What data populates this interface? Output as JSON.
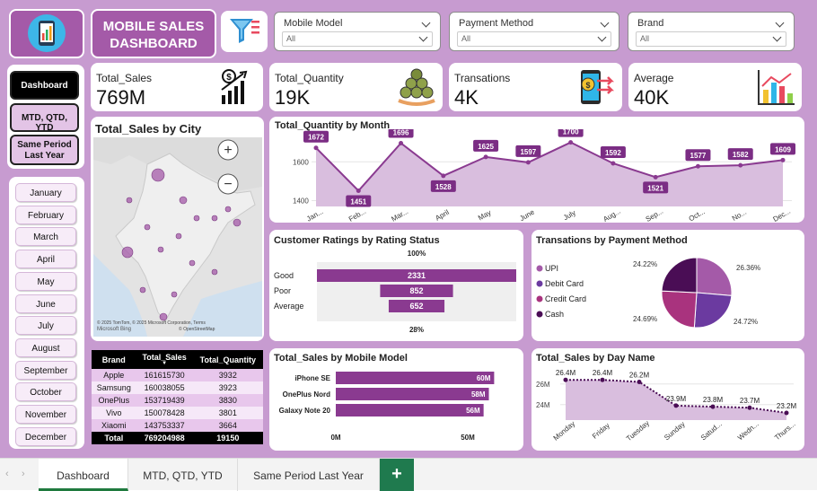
{
  "header": {
    "title_line1": "MOBILE SALES",
    "title_line2": "DASHBOARD"
  },
  "slicers": [
    {
      "label": "Mobile Model",
      "value": "All"
    },
    {
      "label": "Payment Method",
      "value": "All"
    },
    {
      "label": "Brand",
      "value": "All"
    }
  ],
  "nav": {
    "dashboard": "Dashboard",
    "mtd": "MTD, QTD, YTD",
    "same_period_line1": "Same Period",
    "same_period_line2": "Last Year"
  },
  "months": [
    "January",
    "February",
    "March",
    "April",
    "May",
    "June",
    "July",
    "August",
    "September",
    "October",
    "November",
    "December"
  ],
  "kpis": [
    {
      "title": "Total_Sales",
      "value": "769M",
      "icon": "bar-growth-icon"
    },
    {
      "title": "Total_Quantity",
      "value": "19K",
      "icon": "coins-icon"
    },
    {
      "title": "Transations",
      "value": "4K",
      "icon": "phone-payment-icon"
    },
    {
      "title": "Average",
      "value": "40K",
      "icon": "chart-trend-icon"
    }
  ],
  "map": {
    "title": "Total_Sales by City",
    "credit": "© 2025 TomTom, © 2025 Microsoft Corporation, Terms",
    "credit2": "© OpenStreetMap",
    "bing": "Microsoft Bing"
  },
  "chart_data": [
    {
      "type": "area",
      "title": "Total_Quantity by Month",
      "categories": [
        "Jan...",
        "Feb...",
        "Mar...",
        "April",
        "May",
        "June",
        "July",
        "Aug...",
        "Sep...",
        "Oct...",
        "No...",
        "Dec..."
      ],
      "values": [
        1672,
        1451,
        1696,
        1528,
        1625,
        1597,
        1700,
        1592,
        1521,
        1577,
        1582,
        1609
      ],
      "yticks": [
        1400,
        1600
      ],
      "ylim": [
        1370,
        1740
      ]
    },
    {
      "type": "bar",
      "title": "Customer Ratings by Rating Status",
      "categories": [
        "Good",
        "Poor",
        "Average"
      ],
      "values": [
        2331,
        852,
        652
      ],
      "top_label": "100%",
      "bottom_label": "28%"
    },
    {
      "type": "pie",
      "title": "Transations by Payment Method",
      "categories": [
        "UPI",
        "Debit Card",
        "Credit Card",
        "Cash"
      ],
      "values": [
        26.36,
        24.72,
        24.69,
        24.22
      ],
      "labels": [
        "26.36%",
        "24.72%",
        "24.69%",
        "24.22%"
      ],
      "colors": [
        "#a45aa8",
        "#6b3aa0",
        "#a9337e",
        "#4a0d55"
      ]
    },
    {
      "type": "bar",
      "title": "Total_Sales by Mobile Model",
      "categories": [
        "iPhone SE",
        "OnePlus Nord",
        "Galaxy Note 20"
      ],
      "values": [
        60,
        58,
        56
      ],
      "labels": [
        "60M",
        "58M",
        "56M"
      ],
      "xticks": [
        "0M",
        "50M"
      ]
    },
    {
      "type": "area",
      "title": "Total_Sales by Day Name",
      "categories": [
        "Monday",
        "Friday",
        "Tuesday",
        "Sunday",
        "Satud...",
        "Wedn...",
        "Thurs..."
      ],
      "values": [
        26.4,
        26.4,
        26.2,
        23.9,
        23.8,
        23.7,
        23.2
      ],
      "labels": [
        "26.4M",
        "26.4M",
        "26.2M",
        "23.9M",
        "23.8M",
        "23.7M",
        "23.2M"
      ],
      "yticks": [
        "24M",
        "26M"
      ],
      "ylim": [
        22.5,
        27.2
      ]
    }
  ],
  "brand_table": {
    "headers": [
      "Brand",
      "Total_Sales",
      "Total_Quantity"
    ],
    "rows": [
      [
        "Apple",
        "161615730",
        "3932"
      ],
      [
        "Samsung",
        "160038055",
        "3923"
      ],
      [
        "OnePlus",
        "153719439",
        "3830"
      ],
      [
        "Vivo",
        "150078428",
        "3801"
      ],
      [
        "Xiaomi",
        "143753337",
        "3664"
      ]
    ],
    "total": [
      "Total",
      "769204988",
      "19150"
    ]
  },
  "tabs": [
    "Dashboard",
    "MTD, QTD, YTD",
    "Same Period Last Year"
  ]
}
